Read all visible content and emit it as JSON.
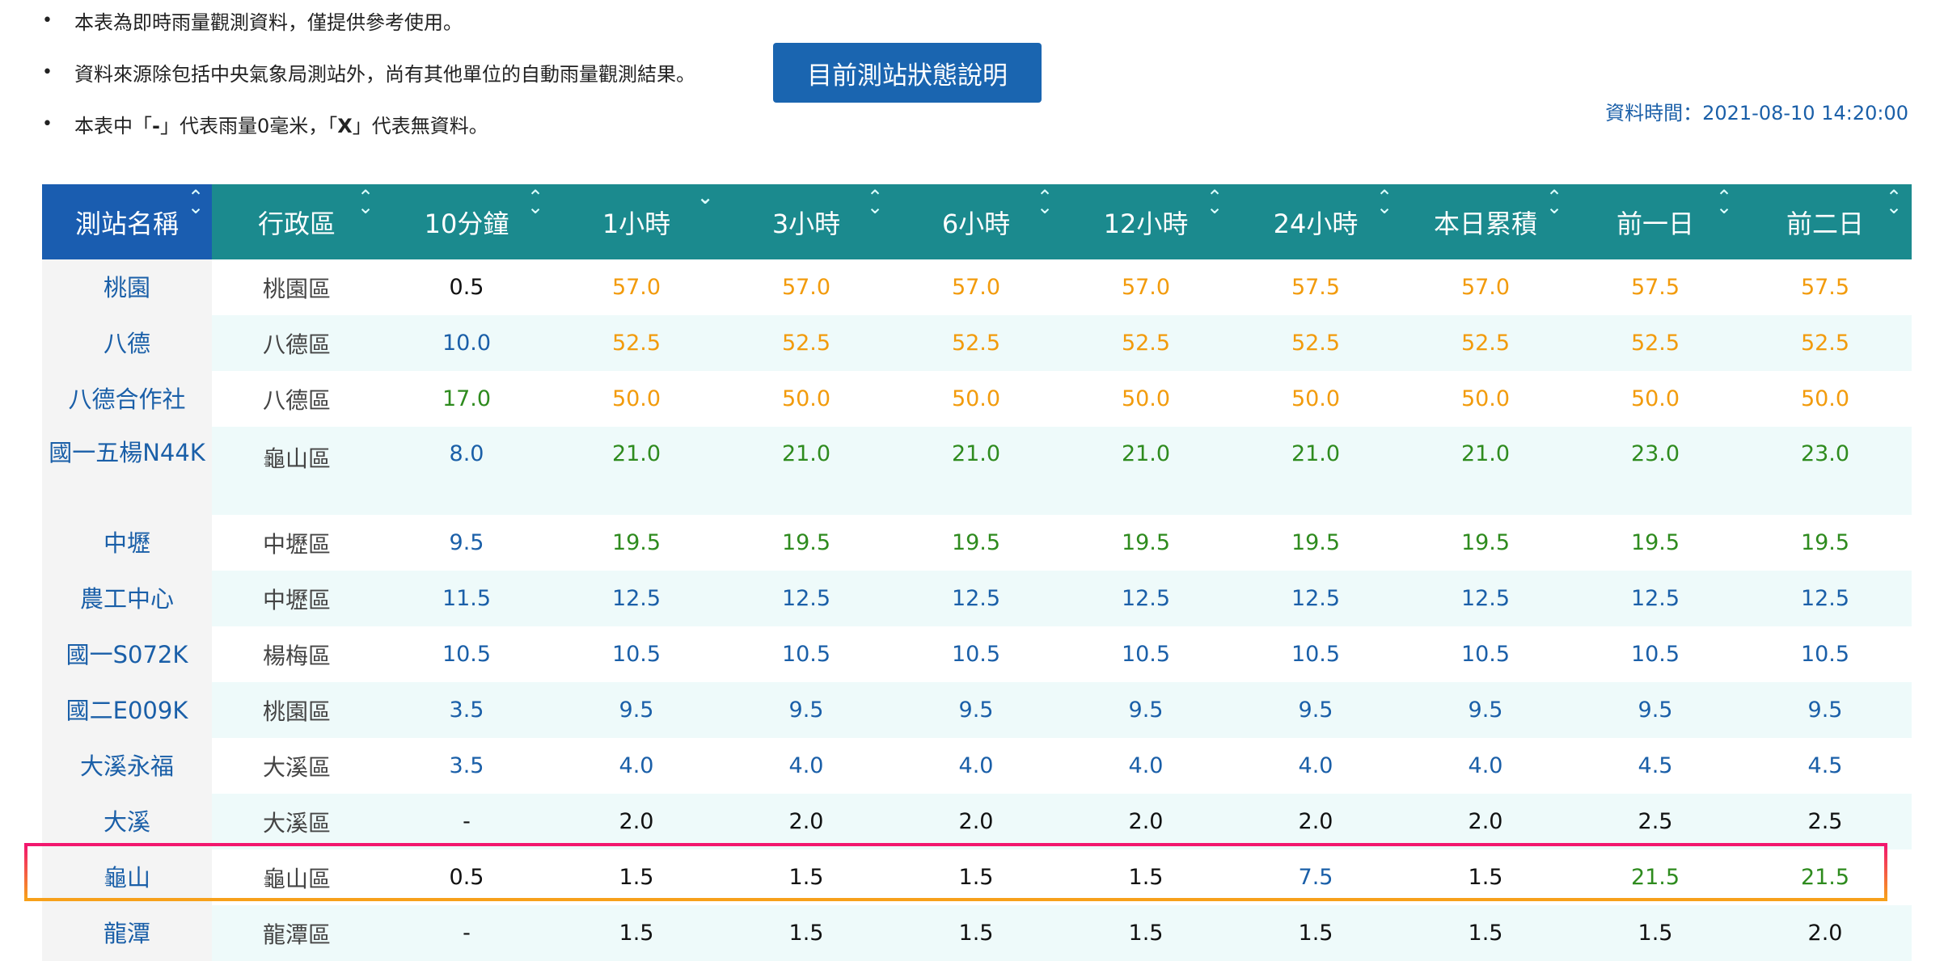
{
  "notes": [
    "本表為即時雨量觀測資料，僅提供參考使用。",
    "資料來源除包括中央氣象局測站外，尚有其他單位的自動雨量觀測結果。",
    [
      "本表中「",
      "-",
      "」代表雨量0毫米，「",
      "X",
      "」代表無資料。"
    ]
  ],
  "status_button": "目前測站狀態說明",
  "data_time": "資料時間：2021-08-10 14:20:00",
  "headers": [
    "測站名稱",
    "行政區",
    "10分鐘",
    "1小時",
    "3小時",
    "6小時",
    "12小時",
    "24小時",
    "本日累積",
    "前一日",
    "前二日"
  ],
  "sort_icons": [
    "⌃⌄",
    "⌃⌄",
    "⌃⌄",
    "⌄",
    "⌃⌄",
    "⌃⌄",
    "⌃⌄",
    "⌃⌄",
    "⌃⌄",
    "⌃⌄",
    "⌃⌄"
  ],
  "colors": {
    "header_bg": "#1b8a8e",
    "header_first_bg": "#1a5db0",
    "button_bg": "#1a65b0",
    "black": "#111111",
    "blue": "#1a5fa8",
    "green": "#2e8b1e",
    "orange": "#f29b0c",
    "highlight_top": "#f2166e",
    "highlight_bottom": "#f7a11a"
  },
  "rows": [
    {
      "name": "桃園",
      "district": "桃園區",
      "values": [
        [
          "0.5",
          "black"
        ],
        [
          "57.0",
          "orange"
        ],
        [
          "57.0",
          "orange"
        ],
        [
          "57.0",
          "orange"
        ],
        [
          "57.0",
          "orange"
        ],
        [
          "57.5",
          "orange"
        ],
        [
          "57.0",
          "orange"
        ],
        [
          "57.5",
          "orange"
        ],
        [
          "57.5",
          "orange"
        ]
      ]
    },
    {
      "name": "八德",
      "district": "八德區",
      "values": [
        [
          "10.0",
          "blue"
        ],
        [
          "52.5",
          "orange"
        ],
        [
          "52.5",
          "orange"
        ],
        [
          "52.5",
          "orange"
        ],
        [
          "52.5",
          "orange"
        ],
        [
          "52.5",
          "orange"
        ],
        [
          "52.5",
          "orange"
        ],
        [
          "52.5",
          "orange"
        ],
        [
          "52.5",
          "orange"
        ]
      ]
    },
    {
      "name": "八德合作社",
      "district": "八德區",
      "values": [
        [
          "17.0",
          "green"
        ],
        [
          "50.0",
          "orange"
        ],
        [
          "50.0",
          "orange"
        ],
        [
          "50.0",
          "orange"
        ],
        [
          "50.0",
          "orange"
        ],
        [
          "50.0",
          "orange"
        ],
        [
          "50.0",
          "orange"
        ],
        [
          "50.0",
          "orange"
        ],
        [
          "50.0",
          "orange"
        ]
      ]
    },
    {
      "name": "國一五楊N44K",
      "district": "龜山區",
      "tall": true,
      "values": [
        [
          "8.0",
          "blue"
        ],
        [
          "21.0",
          "green"
        ],
        [
          "21.0",
          "green"
        ],
        [
          "21.0",
          "green"
        ],
        [
          "21.0",
          "green"
        ],
        [
          "21.0",
          "green"
        ],
        [
          "21.0",
          "green"
        ],
        [
          "23.0",
          "green"
        ],
        [
          "23.0",
          "green"
        ]
      ]
    },
    {
      "name": "中壢",
      "district": "中壢區",
      "values": [
        [
          "9.5",
          "blue"
        ],
        [
          "19.5",
          "green"
        ],
        [
          "19.5",
          "green"
        ],
        [
          "19.5",
          "green"
        ],
        [
          "19.5",
          "green"
        ],
        [
          "19.5",
          "green"
        ],
        [
          "19.5",
          "green"
        ],
        [
          "19.5",
          "green"
        ],
        [
          "19.5",
          "green"
        ]
      ]
    },
    {
      "name": "農工中心",
      "district": "中壢區",
      "values": [
        [
          "11.5",
          "blue"
        ],
        [
          "12.5",
          "blue"
        ],
        [
          "12.5",
          "blue"
        ],
        [
          "12.5",
          "blue"
        ],
        [
          "12.5",
          "blue"
        ],
        [
          "12.5",
          "blue"
        ],
        [
          "12.5",
          "blue"
        ],
        [
          "12.5",
          "blue"
        ],
        [
          "12.5",
          "blue"
        ]
      ]
    },
    {
      "name": "國一S072K",
      "district": "楊梅區",
      "values": [
        [
          "10.5",
          "blue"
        ],
        [
          "10.5",
          "blue"
        ],
        [
          "10.5",
          "blue"
        ],
        [
          "10.5",
          "blue"
        ],
        [
          "10.5",
          "blue"
        ],
        [
          "10.5",
          "blue"
        ],
        [
          "10.5",
          "blue"
        ],
        [
          "10.5",
          "blue"
        ],
        [
          "10.5",
          "blue"
        ]
      ]
    },
    {
      "name": "國二E009K",
      "district": "桃園區",
      "values": [
        [
          "3.5",
          "blue"
        ],
        [
          "9.5",
          "blue"
        ],
        [
          "9.5",
          "blue"
        ],
        [
          "9.5",
          "blue"
        ],
        [
          "9.5",
          "blue"
        ],
        [
          "9.5",
          "blue"
        ],
        [
          "9.5",
          "blue"
        ],
        [
          "9.5",
          "blue"
        ],
        [
          "9.5",
          "blue"
        ]
      ]
    },
    {
      "name": "大溪永福",
      "district": "大溪區",
      "values": [
        [
          "3.5",
          "blue"
        ],
        [
          "4.0",
          "blue"
        ],
        [
          "4.0",
          "blue"
        ],
        [
          "4.0",
          "blue"
        ],
        [
          "4.0",
          "blue"
        ],
        [
          "4.0",
          "blue"
        ],
        [
          "4.0",
          "blue"
        ],
        [
          "4.5",
          "blue"
        ],
        [
          "4.5",
          "blue"
        ]
      ]
    },
    {
      "name": "大溪",
      "district": "大溪區",
      "values": [
        [
          "-",
          "black"
        ],
        [
          "2.0",
          "black"
        ],
        [
          "2.0",
          "black"
        ],
        [
          "2.0",
          "black"
        ],
        [
          "2.0",
          "black"
        ],
        [
          "2.0",
          "black"
        ],
        [
          "2.0",
          "black"
        ],
        [
          "2.5",
          "black"
        ],
        [
          "2.5",
          "black"
        ]
      ]
    },
    {
      "name": "龜山",
      "district": "龜山區",
      "highlighted": true,
      "values": [
        [
          "0.5",
          "black"
        ],
        [
          "1.5",
          "black"
        ],
        [
          "1.5",
          "black"
        ],
        [
          "1.5",
          "black"
        ],
        [
          "1.5",
          "black"
        ],
        [
          "7.5",
          "blue"
        ],
        [
          "1.5",
          "black"
        ],
        [
          "21.5",
          "green"
        ],
        [
          "21.5",
          "green"
        ]
      ]
    },
    {
      "name": "龍潭",
      "district": "龍潭區",
      "values": [
        [
          "-",
          "black"
        ],
        [
          "1.5",
          "black"
        ],
        [
          "1.5",
          "black"
        ],
        [
          "1.5",
          "black"
        ],
        [
          "1.5",
          "black"
        ],
        [
          "1.5",
          "black"
        ],
        [
          "1.5",
          "black"
        ],
        [
          "1.5",
          "black"
        ],
        [
          "2.0",
          "black"
        ]
      ]
    }
  ]
}
